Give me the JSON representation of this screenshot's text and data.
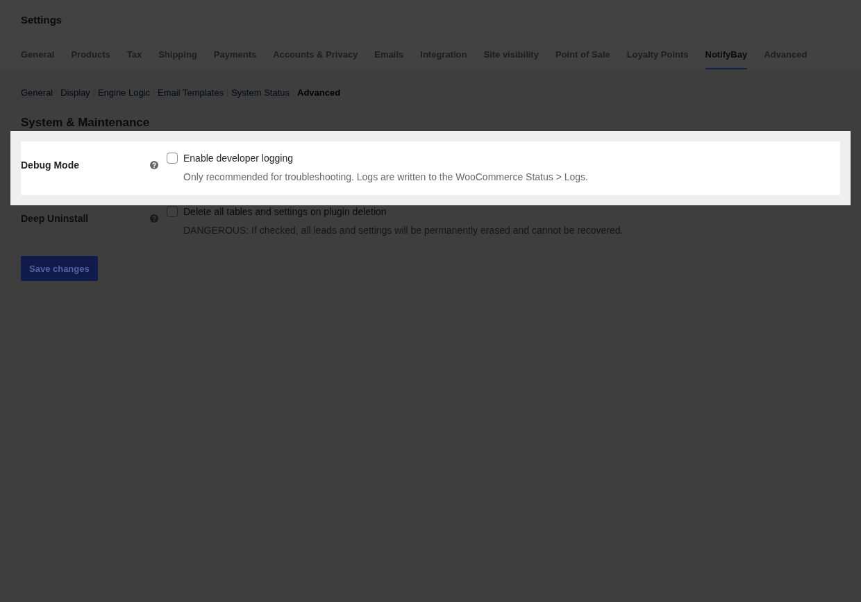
{
  "page": {
    "title": "Settings"
  },
  "tabs": [
    {
      "label": "General",
      "selected": false
    },
    {
      "label": "Products",
      "selected": false
    },
    {
      "label": "Tax",
      "selected": false
    },
    {
      "label": "Shipping",
      "selected": false
    },
    {
      "label": "Payments",
      "selected": false
    },
    {
      "label": "Accounts & Privacy",
      "selected": false
    },
    {
      "label": "Emails",
      "selected": false
    },
    {
      "label": "Integration",
      "selected": false
    },
    {
      "label": "Site visibility",
      "selected": false
    },
    {
      "label": "Point of Sale",
      "selected": false
    },
    {
      "label": "Loyalty Points",
      "selected": false
    },
    {
      "label": "NotifyBay",
      "selected": true
    },
    {
      "label": "Advanced",
      "selected": false
    }
  ],
  "section_nav": [
    {
      "label": "General",
      "selected": false
    },
    {
      "label": "Display",
      "selected": false
    },
    {
      "label": "Engine Logic",
      "selected": false
    },
    {
      "label": "Email Templates",
      "selected": false
    },
    {
      "label": "System Status",
      "selected": false
    },
    {
      "label": "Advanced",
      "selected": true
    }
  ],
  "section": {
    "heading": "System & Maintenance",
    "settings": [
      {
        "label": "Debug Mode",
        "checkbox_label": "Enable developer logging",
        "checked": false,
        "description": "Only recommended for troubleshooting. Logs are written to the WooCommerce Status > Logs.",
        "highlighted": true
      },
      {
        "label": "Deep Uninstall",
        "checkbox_label": "Delete all tables and settings on plugin deletion",
        "checked": false,
        "description": "DANGEROUS: If checked, all leads and settings will be permanently erased and cannot be recovered.",
        "highlighted": false
      }
    ]
  },
  "save_button": {
    "label": "Save changes"
  }
}
